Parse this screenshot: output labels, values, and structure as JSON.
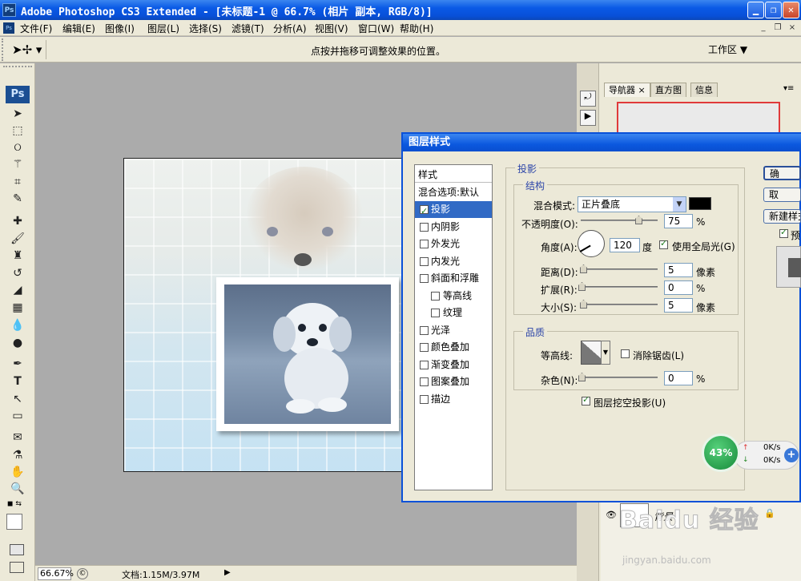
{
  "window": {
    "title": "Adobe Photoshop CS3 Extended - [未标题-1 @ 66.7% (相片 副本, RGB/8)]",
    "logo": "Ps"
  },
  "menubar": {
    "items": [
      "文件(F)",
      "编辑(E)",
      "图像(I)",
      "图层(L)",
      "选择(S)",
      "滤镜(T)",
      "分析(A)",
      "视图(V)",
      "窗口(W)",
      "帮助(H)"
    ]
  },
  "optionsbar": {
    "hint": "点按并拖移可调整效果的位置。",
    "workspace": "工作区"
  },
  "toolbar": {
    "badge": "Ps",
    "icons": [
      "move-icon",
      "marquee-icon",
      "lasso-icon",
      "magic-wand-icon",
      "crop-icon",
      "slice-icon",
      "healing-brush-icon",
      "brush-icon",
      "clone-stamp-icon",
      "history-brush-icon",
      "eraser-icon",
      "gradient-icon",
      "blur-icon",
      "dodge-icon",
      "pen-icon",
      "type-icon",
      "path-select-icon",
      "shape-icon",
      "notes-icon",
      "eyedropper-icon",
      "hand-icon",
      "zoom-icon"
    ]
  },
  "statusbar": {
    "zoom": "66.67%",
    "docinfo": "文档:1.15M/3.97M"
  },
  "panels": {
    "tabs": [
      "导航器",
      "直方图",
      "信息"
    ],
    "layer_name": "背景"
  },
  "dialog": {
    "title": "图层样式",
    "styles_header": "样式",
    "blend_default": "混合选项:默认",
    "styles": [
      {
        "label": "投影",
        "checked": true,
        "selected": true,
        "indent": false
      },
      {
        "label": "内阴影",
        "checked": false,
        "selected": false,
        "indent": false
      },
      {
        "label": "外发光",
        "checked": false,
        "selected": false,
        "indent": false
      },
      {
        "label": "内发光",
        "checked": false,
        "selected": false,
        "indent": false
      },
      {
        "label": "斜面和浮雕",
        "checked": false,
        "selected": false,
        "indent": false
      },
      {
        "label": "等高线",
        "checked": false,
        "selected": false,
        "indent": true
      },
      {
        "label": "纹理",
        "checked": false,
        "selected": false,
        "indent": true
      },
      {
        "label": "光泽",
        "checked": false,
        "selected": false,
        "indent": false
      },
      {
        "label": "颜色叠加",
        "checked": false,
        "selected": false,
        "indent": false
      },
      {
        "label": "渐变叠加",
        "checked": false,
        "selected": false,
        "indent": false
      },
      {
        "label": "图案叠加",
        "checked": false,
        "selected": false,
        "indent": false
      },
      {
        "label": "描边",
        "checked": false,
        "selected": false,
        "indent": false
      }
    ],
    "section_title": "投影",
    "structure_title": "结构",
    "blend_mode_label": "混合模式:",
    "blend_mode_value": "正片叠底",
    "shadow_color": "#000000",
    "opacity_label": "不透明度(O):",
    "opacity_value": "75",
    "opacity_fraction": 0.75,
    "percent": "%",
    "angle_label": "角度(A):",
    "angle_value": "120",
    "angle_unit": "度",
    "global_light_label": "使用全局光(G)",
    "distance_label": "距离(D):",
    "distance_value": "5",
    "spread_label": "扩展(R):",
    "spread_value": "0",
    "size_label": "大小(S):",
    "size_value": "5",
    "pixels": "像素",
    "quality_title": "品质",
    "contour_label": "等高线:",
    "antialias_label": "消除锯齿(L)",
    "noise_label": "杂色(N):",
    "noise_value": "0",
    "knockout_label": "图层挖空投影(U)",
    "buttons": {
      "ok": "确",
      "cancel": "取",
      "new_style": "新建样式",
      "preview": "预览"
    }
  },
  "network": {
    "percent": "43%",
    "up": "0K/s",
    "down": "0K/s"
  },
  "watermark": {
    "brand": "Baidu 经验",
    "url": "jingyan.baidu.com"
  }
}
